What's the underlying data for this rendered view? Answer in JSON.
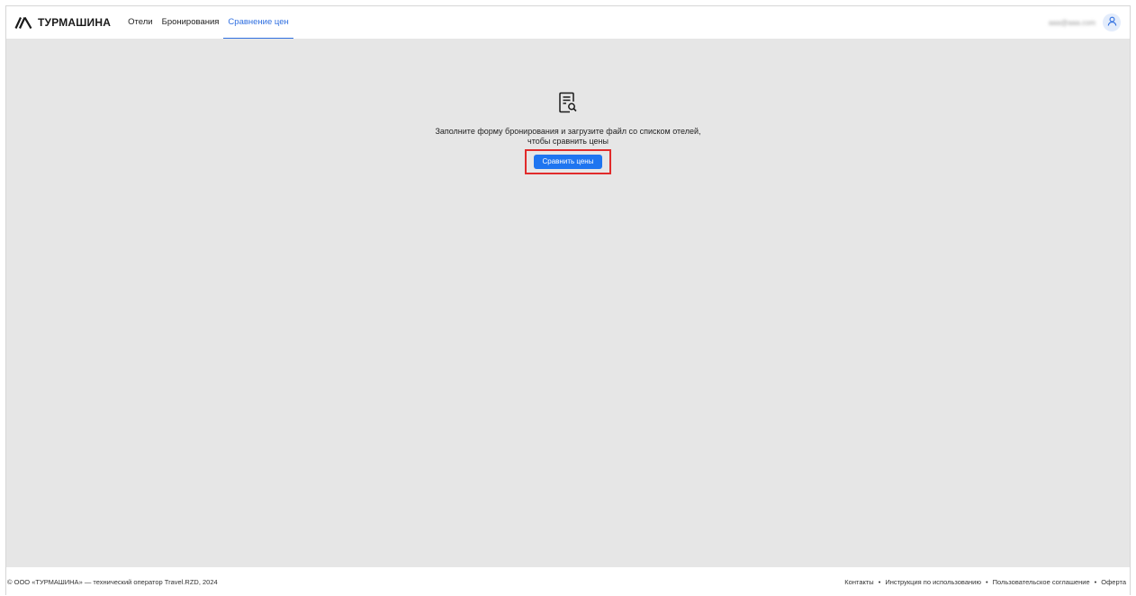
{
  "header": {
    "brand": "ТУРМАШИНА",
    "nav": [
      {
        "label": "Отели",
        "active": false
      },
      {
        "label": "Бронирования",
        "active": false
      },
      {
        "label": "Сравнение цен",
        "active": true
      }
    ],
    "user_email": "aaa@aaa.com",
    "icons": {
      "logo": "brand-logo-icon",
      "avatar": "user-icon"
    }
  },
  "main": {
    "icon": "document-search-icon",
    "message_line1": "Заполните форму бронирования и загрузите файл со списком отелей,",
    "message_line2": "чтобы сравнить цены",
    "button_label": "Сравнить цены"
  },
  "footer": {
    "copyright": "© ООО «ТУРМАШИНА» — технический оператор Travel.RZD, 2024",
    "links": [
      "Контакты",
      "Инструкция по использованию",
      "Пользовательское соглашение",
      "Оферта"
    ],
    "separator": "•"
  },
  "colors": {
    "accent": "#2f6fe0",
    "button": "#1f75f0",
    "content_bg": "#e6e6e6",
    "highlight_border": "#e12b2b"
  }
}
